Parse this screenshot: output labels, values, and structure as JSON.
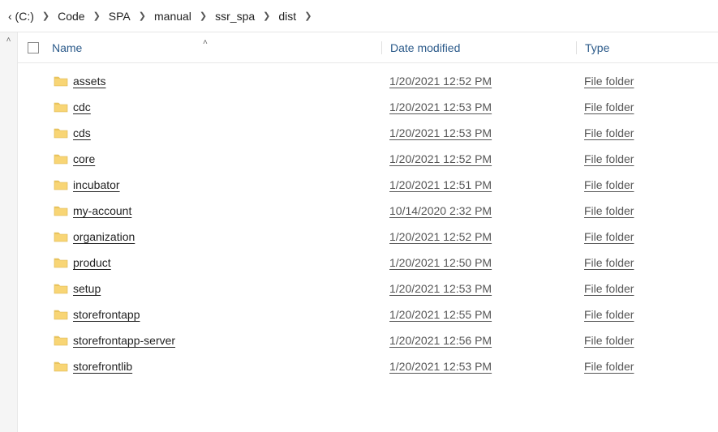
{
  "breadcrumb": {
    "items": [
      {
        "label": "‹ (C:)"
      },
      {
        "label": "Code"
      },
      {
        "label": "SPA"
      },
      {
        "label": "manual"
      },
      {
        "label": "ssr_spa"
      },
      {
        "label": "dist"
      }
    ]
  },
  "columns": {
    "name": "Name",
    "date": "Date modified",
    "type": "Type"
  },
  "rows": [
    {
      "name": "assets",
      "date": "1/20/2021 12:52 PM",
      "type": "File folder"
    },
    {
      "name": "cdc",
      "date": "1/20/2021 12:53 PM",
      "type": "File folder"
    },
    {
      "name": "cds",
      "date": "1/20/2021 12:53 PM",
      "type": "File folder"
    },
    {
      "name": "core",
      "date": "1/20/2021 12:52 PM",
      "type": "File folder"
    },
    {
      "name": "incubator",
      "date": "1/20/2021 12:51 PM",
      "type": "File folder"
    },
    {
      "name": "my-account",
      "date": "10/14/2020 2:32 PM",
      "type": "File folder"
    },
    {
      "name": "organization",
      "date": "1/20/2021 12:52 PM",
      "type": "File folder"
    },
    {
      "name": "product",
      "date": "1/20/2021 12:50 PM",
      "type": "File folder"
    },
    {
      "name": "setup",
      "date": "1/20/2021 12:53 PM",
      "type": "File folder"
    },
    {
      "name": "storefrontapp",
      "date": "1/20/2021 12:55 PM",
      "type": "File folder"
    },
    {
      "name": "storefrontapp-server",
      "date": "1/20/2021 12:56 PM",
      "type": "File folder"
    },
    {
      "name": "storefrontlib",
      "date": "1/20/2021 12:53 PM",
      "type": "File folder"
    }
  ]
}
